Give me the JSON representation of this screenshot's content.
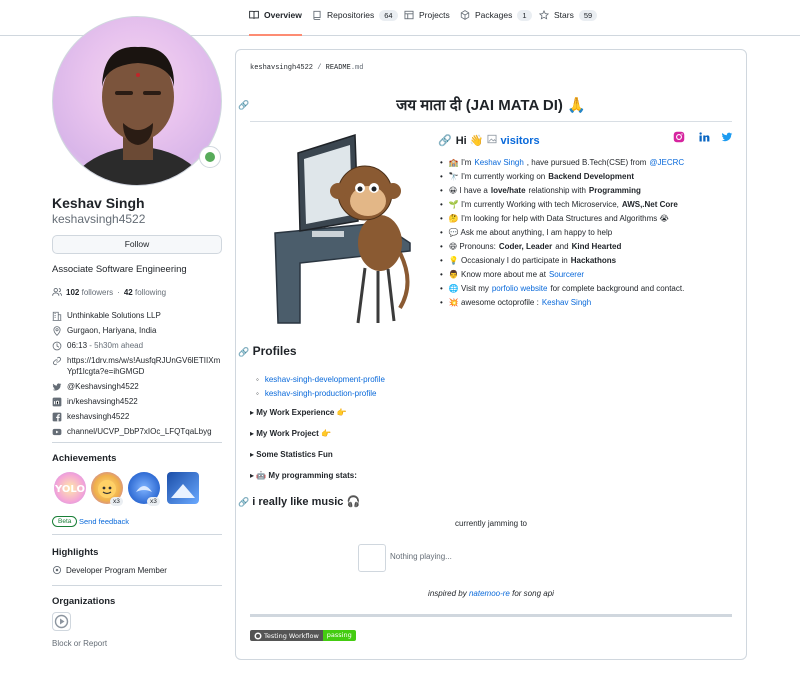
{
  "nav": {
    "tabs": [
      {
        "label": "Overview",
        "count": ""
      },
      {
        "label": "Repositories",
        "count": "64"
      },
      {
        "label": "Projects",
        "count": ""
      },
      {
        "label": "Packages",
        "count": "1"
      },
      {
        "label": "Stars",
        "count": "59"
      }
    ]
  },
  "profile": {
    "name": "Keshav Singh",
    "login": "keshavsingh4522",
    "follow_label": "Follow",
    "bio": "Associate Software Engineering",
    "followers_count": "102",
    "followers_label": "followers",
    "dot": "·",
    "following_count": "42",
    "following_label": "following",
    "company": "Unthinkable Solutions LLP",
    "location": "Gurgaon, Hariyana, India",
    "time": "06:13",
    "time_offset": "- 5h30m ahead",
    "website_line1": "https://1drv.ms/w/s!AusfqRJUnGV6lETIIXm",
    "website_line2": "Ypf1lcgta?e=ihGMGD",
    "twitter": "@Keshavsingh4522",
    "linkedin": "in/keshavsingh4522",
    "facebook": "keshavsingh4522",
    "youtube": "channel/UCVP_DbP7xIOc_LFQTqaLbyg"
  },
  "achievements": {
    "title": "Achievements",
    "badge1_mult": "x3",
    "badge2_mult": "x3",
    "badge3_text": "YOLO",
    "beta": "Beta",
    "feedback": "Send feedback"
  },
  "highlights": {
    "title": "Highlights",
    "item": "Developer Program Member"
  },
  "organizations": {
    "title": "Organizations"
  },
  "block_report": "Block or Report",
  "readme": {
    "path_user": "keshavsingh4522",
    "path_sep": "/",
    "path_file": "README",
    "path_ext": ".md",
    "title": "जय माता दी (JAI MATA DI) 🙏",
    "hi": "Hi 👋",
    "visitors": "visitors",
    "bullets": [
      {
        "pre": "🏫 I'm",
        "link": "Keshav Singh",
        "mid": ", have pursued B.Tech(CSE) from",
        "link2": "@JECRC",
        "post": ""
      },
      {
        "pre": "🔭 I'm currently working on",
        "bold": "Backend Development",
        "post": ""
      },
      {
        "pre": "😀 I have a",
        "bold": "love/hate",
        "post": "relationship with",
        "bold2": "Programming"
      },
      {
        "pre": "🌱 I'm currently Working with tech Microservice,",
        "bold": "AWS,.Net Core",
        "post": ""
      },
      {
        "pre": "🤔 I'm looking for help with Data Structures and Algorithms 😭",
        "post": ""
      },
      {
        "pre": "💬 Ask me about anything, I am happy to help",
        "post": ""
      },
      {
        "pre": "😄 Pronouns:",
        "bold": "Coder, Leader",
        "post": "and",
        "bold2": "Kind Hearted"
      },
      {
        "pre": "💡 Occasionaly I do participate in",
        "bold": "Hackathons",
        "post": ""
      },
      {
        "pre": "👨 Know more about me at",
        "link": "Sourcerer",
        "post": ""
      },
      {
        "pre": "🌐 Visit my",
        "link": "porfolio website",
        "post": "for complete background and contact."
      },
      {
        "pre": "💥 awesome octoprofile :",
        "link": "Keshav Singh",
        "post": ""
      }
    ],
    "profiles_title": "Profiles",
    "profile_links": [
      "keshav-singh-development-profile",
      "keshav-singh-production-profile"
    ],
    "details": [
      "My Work Experience 👉",
      "My Work Project 👉",
      "Some Statistics Fun",
      "🤖 My programming stats:"
    ],
    "music_title": "i really like music 🎧",
    "jamming": "currently jamming to",
    "nothing_playing": "Nothing playing...",
    "inspired_pre": "inspired by",
    "inspired_link": "natemoo-re",
    "inspired_post": "for song api",
    "badge_label": "Testing Workflow",
    "badge_status": "passing"
  },
  "colors": {
    "accent": "#0969da",
    "tab_underline": "#fd8c73",
    "status_green": "#57ab5a",
    "badge_green": "#44cc11"
  }
}
